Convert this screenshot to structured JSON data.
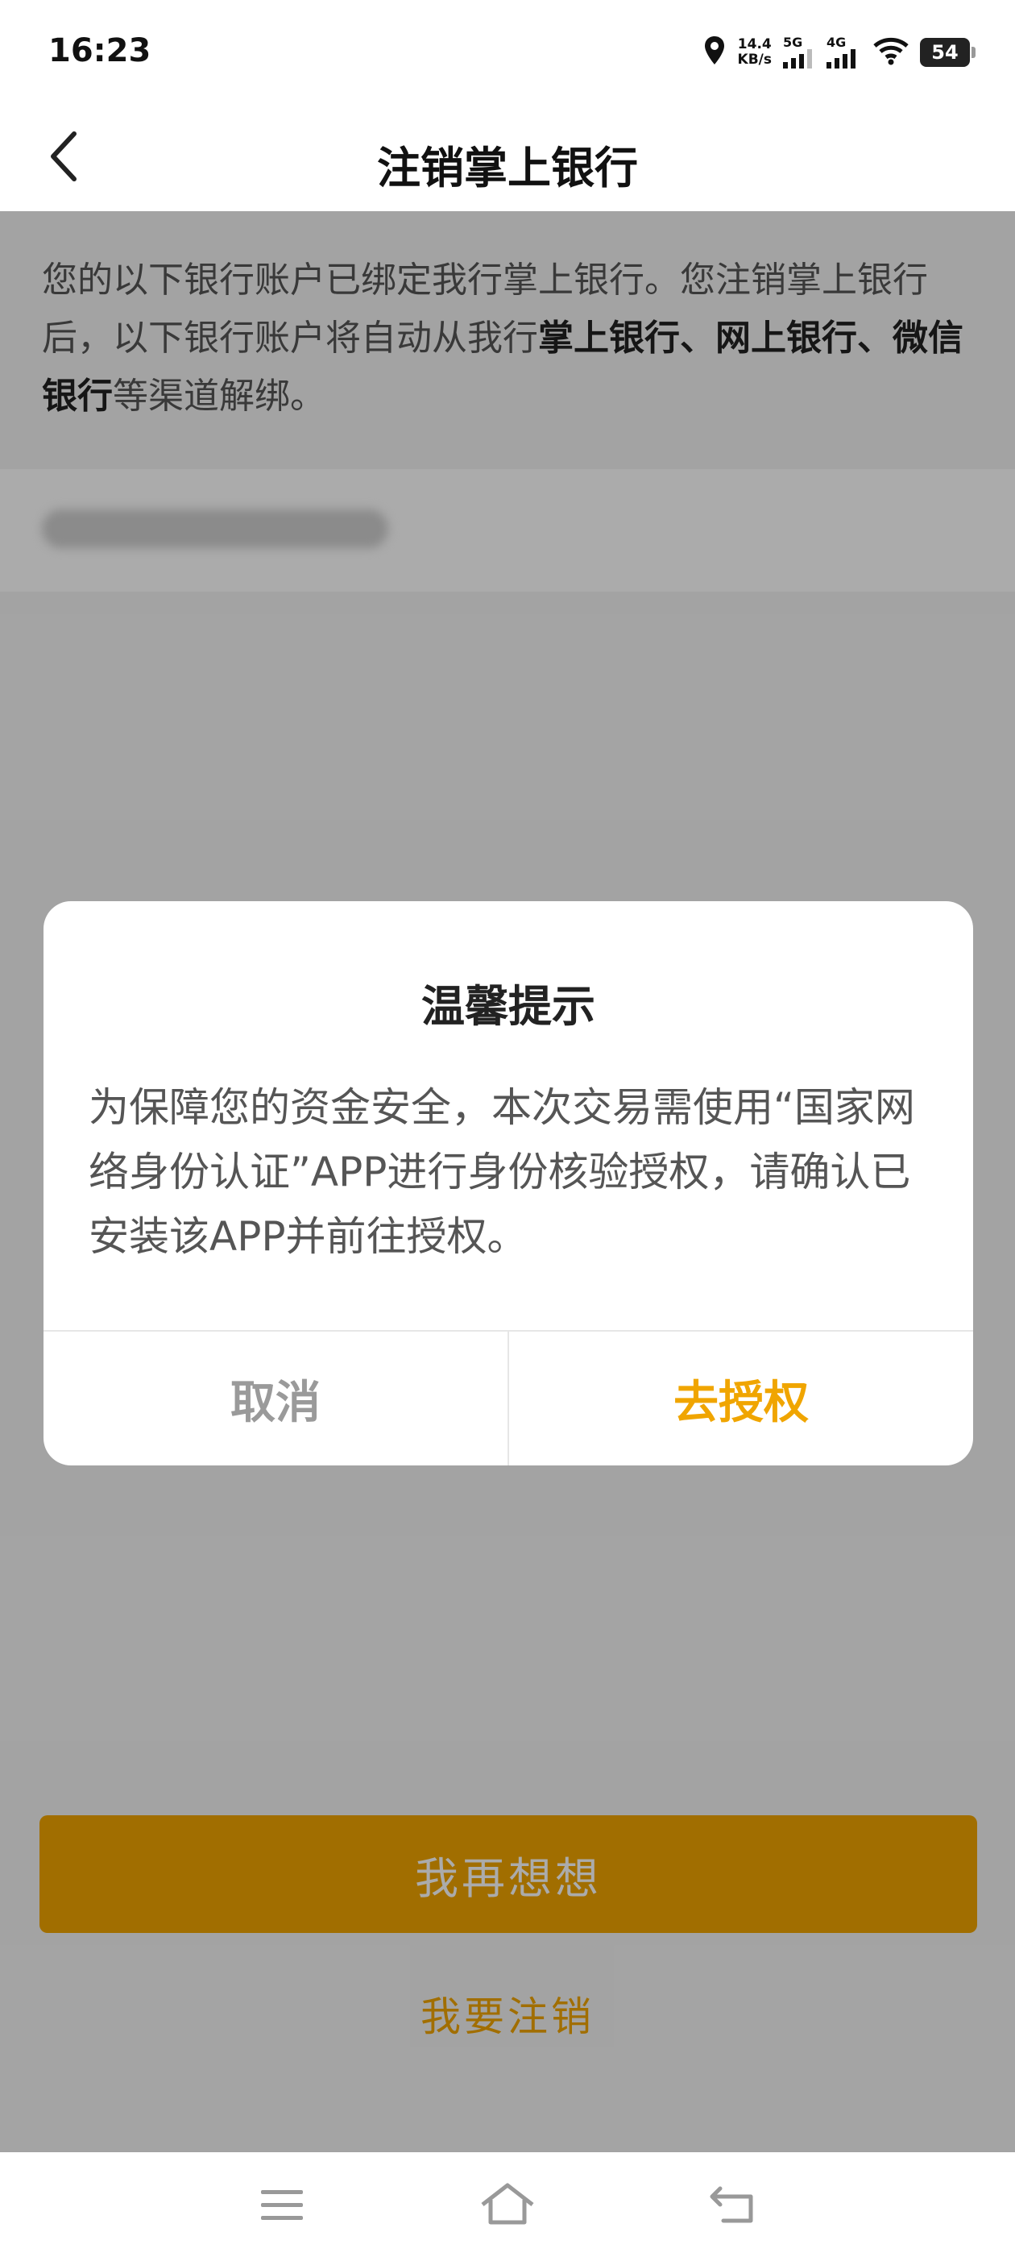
{
  "status_bar": {
    "time": "16:23",
    "net_speed_value": "14.4",
    "net_speed_unit": "KB/s",
    "sim1_label": "5G",
    "sim2_label": "4G",
    "battery": "54"
  },
  "header": {
    "title": "注销掌上银行"
  },
  "content": {
    "desc_part1": "您的以下银行账户已绑定我行掌上银行。您注销掌上银行后，以下银行账户将自动从我行",
    "desc_bold": "掌上银行、网上银行、微信银行",
    "desc_part2": "等渠道解绑。",
    "primary_button": "我再想想",
    "link_button": "我要注销"
  },
  "dialog": {
    "title": "温馨提示",
    "message": "为保障您的资金安全，本次交易需使用“国家网络身份认证”APP进行身份核验授权，请确认已安装该APP并前往授权。",
    "cancel": "取消",
    "confirm": "去授权"
  },
  "colors": {
    "accent": "#f0a500",
    "overlay": "rgba(0,0,0,0.33)"
  }
}
